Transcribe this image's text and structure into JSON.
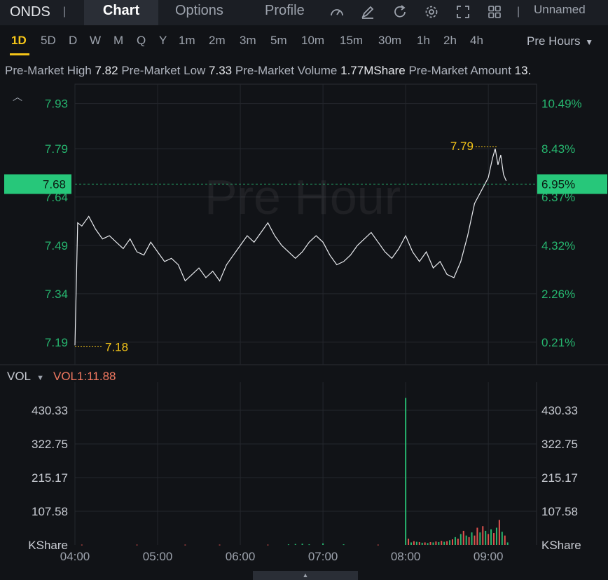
{
  "header": {
    "ticker": "ONDS",
    "separator": "|",
    "tabs": [
      {
        "label": "Chart",
        "active": true
      },
      {
        "label": "Options",
        "active": false
      },
      {
        "label": "Profile",
        "active": false
      }
    ],
    "tools": [
      "gauge-icon",
      "edit-icon",
      "refresh-icon",
      "gear-icon",
      "fullscreen-icon",
      "grid-icon"
    ],
    "layout_name": "Unnamed"
  },
  "periods": [
    "1D",
    "5D",
    "D",
    "W",
    "M",
    "Q",
    "Y",
    "1m",
    "2m",
    "3m",
    "5m",
    "10m",
    "15m",
    "30m",
    "1h",
    "2h",
    "4h"
  ],
  "active_period": "1D",
  "session": {
    "label": "Pre Hours",
    "icon": "caret-down-icon"
  },
  "stats": [
    {
      "label": "Pre-Market High",
      "value": "7.82"
    },
    {
      "label": "Pre-Market Low",
      "value": "7.33"
    },
    {
      "label": "Pre-Market Volume",
      "value": "1.77MShare"
    },
    {
      "label": "Pre-Market Amount",
      "value": "13."
    }
  ],
  "watermark": "Pre Hour",
  "colors": {
    "up": "#26b66f",
    "down": "#e0524e",
    "highlight": "#f5c518",
    "price_badge": "#27c77a"
  },
  "chart_data": [
    {
      "type": "line",
      "title": "",
      "x_ticks": [
        "04:00",
        "05:00",
        "06:00",
        "07:00",
        "08:00",
        "09:00"
      ],
      "xlim": [
        "04:00",
        "09:35"
      ],
      "y_ticks_left": [
        "7.93",
        "7.79",
        "7.64",
        "7.49",
        "7.34",
        "7.19"
      ],
      "y_ticks_right": [
        "10.49%",
        "8.43%",
        "6.37%",
        "4.32%",
        "2.26%",
        "0.21%"
      ],
      "y_tick_values": [
        7.93,
        7.79,
        7.64,
        7.49,
        7.34,
        7.19
      ],
      "ylim": [
        7.12,
        7.99
      ],
      "grid": true,
      "current_price": {
        "value": 7.68,
        "label": "7.68",
        "change_label": "6.95%"
      },
      "max_marker": {
        "value": 7.79,
        "label": "7.79",
        "time": "09:07"
      },
      "min_marker": {
        "value": 7.18,
        "label": "7.18",
        "time": "04:00"
      },
      "series": [
        {
          "x": [
            "04:00",
            "04:02",
            "04:05",
            "04:10",
            "04:15",
            "04:20",
            "04:25",
            "04:30",
            "04:35",
            "04:40",
            "04:45",
            "04:50",
            "04:55",
            "05:00",
            "05:05",
            "05:10",
            "05:15",
            "05:20",
            "05:25",
            "05:30",
            "05:35",
            "05:40",
            "05:45",
            "05:50",
            "05:55",
            "06:00",
            "06:05",
            "06:10",
            "06:15",
            "06:20",
            "06:25",
            "06:30",
            "06:35",
            "06:40",
            "06:45",
            "06:50",
            "06:55",
            "07:00",
            "07:05",
            "07:10",
            "07:15",
            "07:20",
            "07:25",
            "07:30",
            "07:35",
            "07:40",
            "07:45",
            "07:50",
            "07:55",
            "08:00",
            "08:05",
            "08:10",
            "08:15",
            "08:20",
            "08:25",
            "08:30",
            "08:35",
            "08:40",
            "08:45",
            "08:50",
            "08:55",
            "09:00",
            "09:03",
            "09:05",
            "09:07",
            "09:09",
            "09:11",
            "09:13"
          ],
          "values": [
            7.18,
            7.56,
            7.55,
            7.58,
            7.54,
            7.51,
            7.52,
            7.5,
            7.48,
            7.51,
            7.47,
            7.46,
            7.5,
            7.47,
            7.44,
            7.45,
            7.43,
            7.38,
            7.4,
            7.42,
            7.39,
            7.41,
            7.38,
            7.43,
            7.46,
            7.49,
            7.52,
            7.5,
            7.53,
            7.56,
            7.52,
            7.49,
            7.47,
            7.45,
            7.47,
            7.5,
            7.52,
            7.5,
            7.46,
            7.43,
            7.44,
            7.46,
            7.49,
            7.51,
            7.53,
            7.5,
            7.47,
            7.45,
            7.48,
            7.52,
            7.47,
            7.44,
            7.47,
            7.42,
            7.44,
            7.4,
            7.39,
            7.44,
            7.52,
            7.62,
            7.66,
            7.7,
            7.76,
            7.79,
            7.74,
            7.77,
            7.71,
            7.69
          ]
        }
      ]
    },
    {
      "type": "bar",
      "title": "VOL",
      "indicator": "VOL1:11.88",
      "indicator_icon": "caret-down-icon",
      "unit_label": "KShare",
      "y_ticks": [
        "430.33",
        "322.75",
        "215.17",
        "107.58"
      ],
      "y_tick_values": [
        430.33,
        322.75,
        215.17,
        107.58
      ],
      "ylim": [
        0,
        520
      ],
      "xlim": [
        "04:00",
        "09:35"
      ],
      "bars": [
        {
          "x": "04:05",
          "v": 1,
          "c": "down"
        },
        {
          "x": "04:45",
          "v": 1,
          "c": "down"
        },
        {
          "x": "05:20",
          "v": 1,
          "c": "down"
        },
        {
          "x": "05:45",
          "v": 1,
          "c": "down"
        },
        {
          "x": "06:20",
          "v": 1,
          "c": "down"
        },
        {
          "x": "06:35",
          "v": 2,
          "c": "up"
        },
        {
          "x": "06:40",
          "v": 3,
          "c": "up"
        },
        {
          "x": "06:45",
          "v": 4,
          "c": "up"
        },
        {
          "x": "06:50",
          "v": 2,
          "c": "up"
        },
        {
          "x": "07:00",
          "v": 5,
          "c": "up"
        },
        {
          "x": "07:15",
          "v": 2,
          "c": "up"
        },
        {
          "x": "07:40",
          "v": 1,
          "c": "down"
        },
        {
          "x": "08:00",
          "v": 470,
          "c": "up"
        },
        {
          "x": "08:02",
          "v": 20,
          "c": "down"
        },
        {
          "x": "08:04",
          "v": 8,
          "c": "up"
        },
        {
          "x": "08:06",
          "v": 12,
          "c": "down"
        },
        {
          "x": "08:08",
          "v": 10,
          "c": "up"
        },
        {
          "x": "08:10",
          "v": 9,
          "c": "down"
        },
        {
          "x": "08:12",
          "v": 7,
          "c": "up"
        },
        {
          "x": "08:14",
          "v": 8,
          "c": "down"
        },
        {
          "x": "08:16",
          "v": 6,
          "c": "up"
        },
        {
          "x": "08:18",
          "v": 9,
          "c": "down"
        },
        {
          "x": "08:20",
          "v": 8,
          "c": "up"
        },
        {
          "x": "08:22",
          "v": 11,
          "c": "down"
        },
        {
          "x": "08:24",
          "v": 9,
          "c": "up"
        },
        {
          "x": "08:26",
          "v": 13,
          "c": "down"
        },
        {
          "x": "08:28",
          "v": 10,
          "c": "up"
        },
        {
          "x": "08:30",
          "v": 12,
          "c": "down"
        },
        {
          "x": "08:32",
          "v": 15,
          "c": "up"
        },
        {
          "x": "08:34",
          "v": 18,
          "c": "down"
        },
        {
          "x": "08:36",
          "v": 25,
          "c": "up"
        },
        {
          "x": "08:38",
          "v": 20,
          "c": "down"
        },
        {
          "x": "08:40",
          "v": 35,
          "c": "up"
        },
        {
          "x": "08:42",
          "v": 45,
          "c": "down"
        },
        {
          "x": "08:44",
          "v": 30,
          "c": "up"
        },
        {
          "x": "08:46",
          "v": 25,
          "c": "down"
        },
        {
          "x": "08:48",
          "v": 40,
          "c": "up"
        },
        {
          "x": "08:50",
          "v": 30,
          "c": "down"
        },
        {
          "x": "08:52",
          "v": 55,
          "c": "down"
        },
        {
          "x": "08:54",
          "v": 40,
          "c": "up"
        },
        {
          "x": "08:56",
          "v": 60,
          "c": "down"
        },
        {
          "x": "08:58",
          "v": 45,
          "c": "up"
        },
        {
          "x": "09:00",
          "v": 35,
          "c": "down"
        },
        {
          "x": "09:02",
          "v": 50,
          "c": "up"
        },
        {
          "x": "09:04",
          "v": 38,
          "c": "down"
        },
        {
          "x": "09:06",
          "v": 55,
          "c": "up"
        },
        {
          "x": "09:08",
          "v": 80,
          "c": "down"
        },
        {
          "x": "09:10",
          "v": 42,
          "c": "up"
        },
        {
          "x": "09:12",
          "v": 30,
          "c": "down"
        },
        {
          "x": "09:14",
          "v": 8,
          "c": "up"
        }
      ]
    }
  ]
}
